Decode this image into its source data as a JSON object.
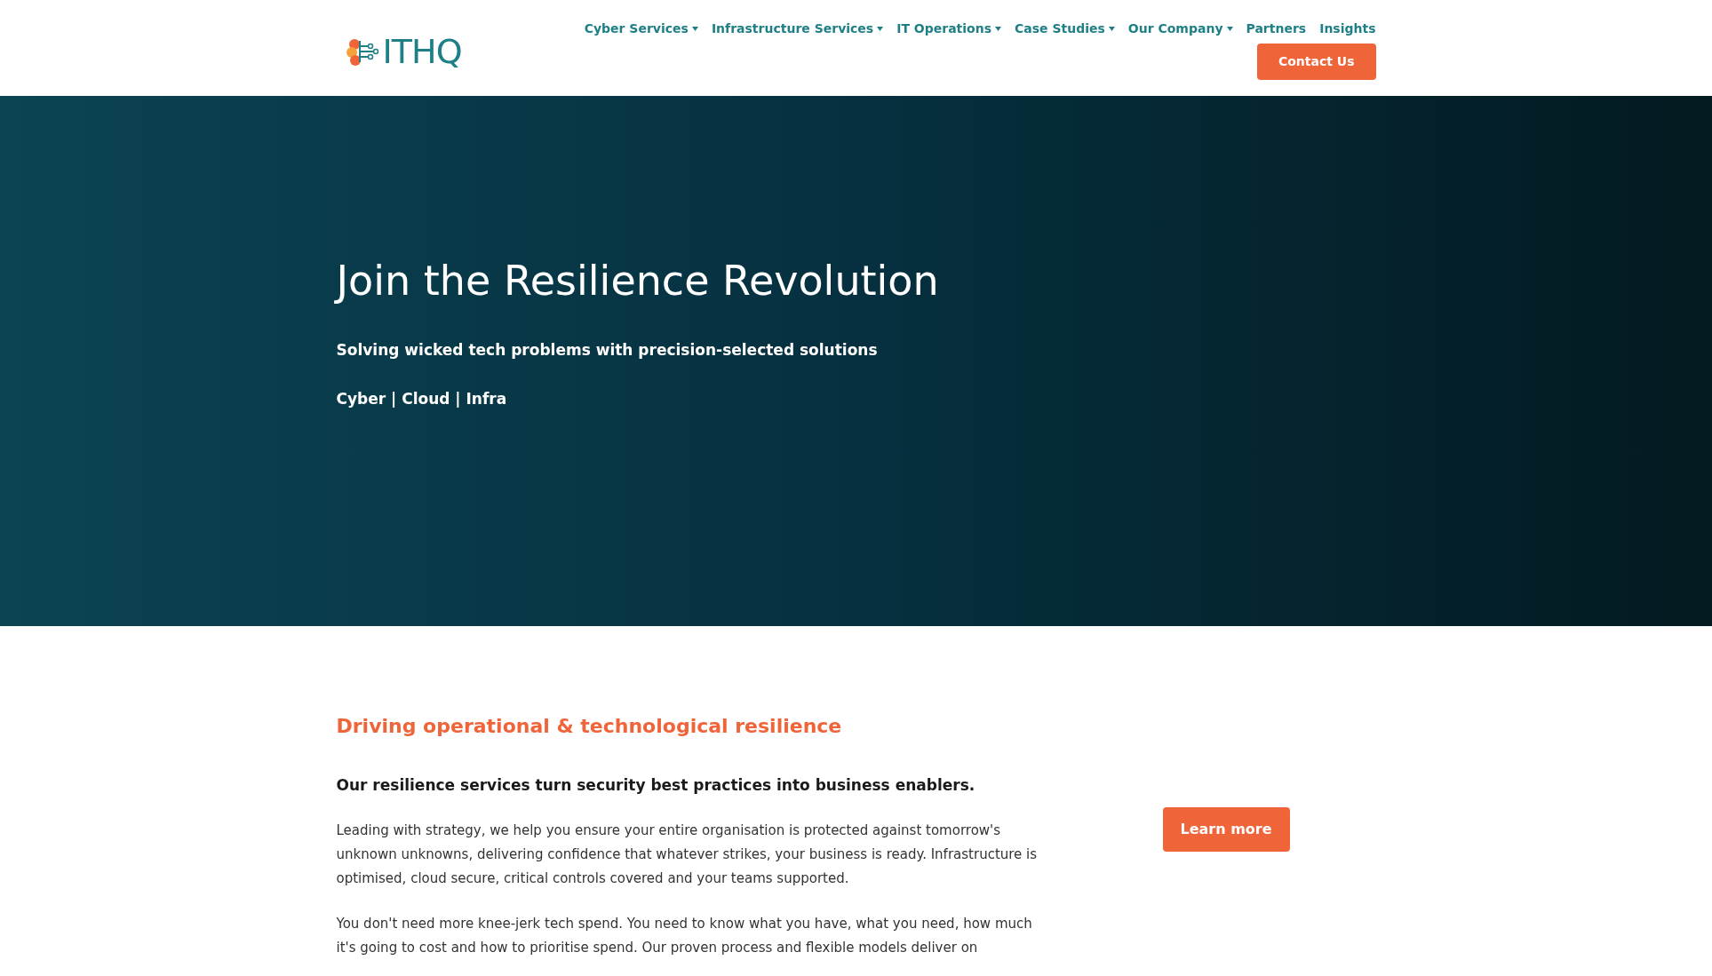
{
  "header": {
    "logo": "ITHQ",
    "nav": [
      {
        "label": "Cyber Services",
        "has_dropdown": true
      },
      {
        "label": "Infrastructure Services",
        "has_dropdown": true
      },
      {
        "label": "IT Operations",
        "has_dropdown": true
      },
      {
        "label": "Case Studies",
        "has_dropdown": true
      },
      {
        "label": "Our Company",
        "has_dropdown": true
      },
      {
        "label": "Partners",
        "has_dropdown": false
      },
      {
        "label": "Insights",
        "has_dropdown": false
      }
    ],
    "cta": "Contact Us"
  },
  "hero": {
    "title": "Join the Resilience Revolution",
    "subtitle": "Solving wicked tech problems with precision-selected solutions",
    "tagline": "Cyber | Cloud | Infra"
  },
  "section": {
    "heading": "Driving operational & technological resilience",
    "lead": "Our resilience services turn security best practices into business enablers.",
    "paragraphs": [
      "Leading with strategy, we help you ensure your entire organisation is protected against tomorrow's unknown unknowns, delivering confidence that whatever strikes, your business is ready. Infrastructure is optimised, cloud secure, critical controls covered and your teams supported.",
      "You don't need more knee-jerk tech spend. You need to know what you have, what you need, how much it's going to cost and how to prioritise spend. Our proven process and flexible models deliver on"
    ],
    "button": "Learn more"
  }
}
